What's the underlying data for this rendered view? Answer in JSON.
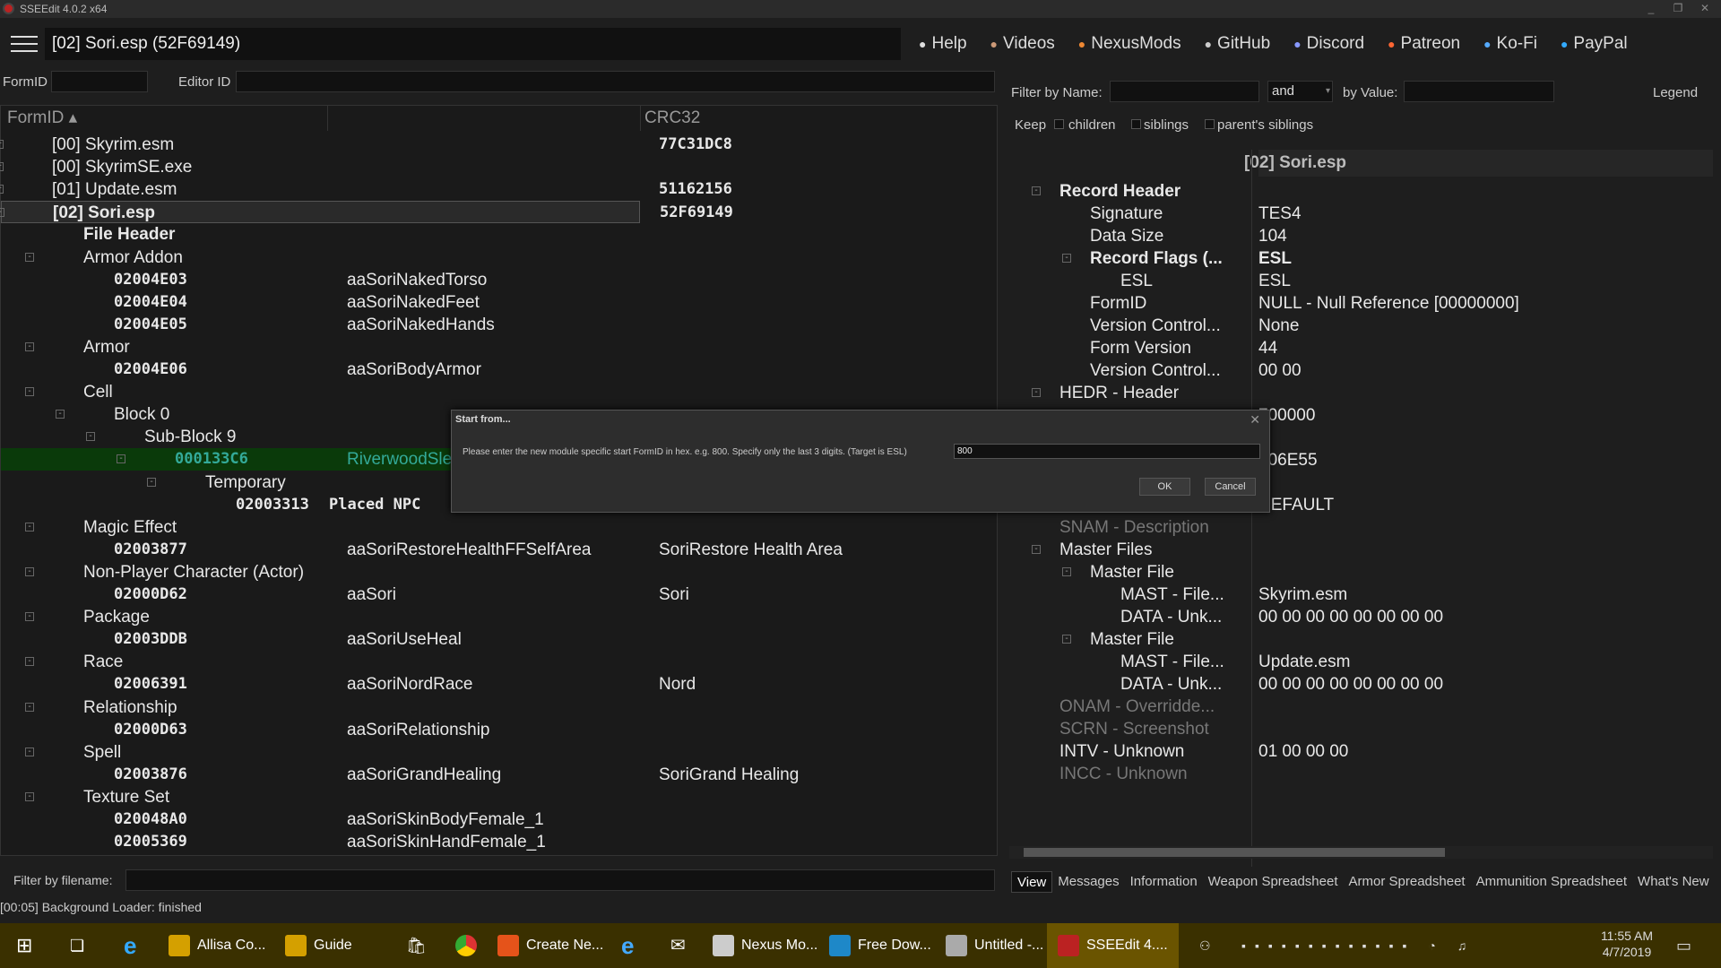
{
  "window": {
    "title": "SSEEdit 4.0.2 x64"
  },
  "header": {
    "title": "[02] Sori.esp (52F69149)",
    "links": [
      {
        "label": "Help",
        "icon": "hat-icon",
        "color": "#ddd"
      },
      {
        "label": "Videos",
        "icon": "videos-icon",
        "color": "#c97"
      },
      {
        "label": "NexusMods",
        "icon": "nexus-icon",
        "color": "#e83"
      },
      {
        "label": "GitHub",
        "icon": "github-icon",
        "color": "#ccc"
      },
      {
        "label": "Discord",
        "icon": "discord-icon",
        "color": "#89f"
      },
      {
        "label": "Patreon",
        "icon": "patreon-icon",
        "color": "#f63"
      },
      {
        "label": "Ko-Fi",
        "icon": "kofi-icon",
        "color": "#5af"
      },
      {
        "label": "PayPal",
        "icon": "paypal-icon",
        "color": "#3af"
      }
    ]
  },
  "filters": {
    "formid_label": "FormID",
    "editorid_label": "Editor ID"
  },
  "tree": {
    "col_formid": "FormID",
    "col_crc": "CRC32",
    "rows": [
      {
        "d": 0,
        "exp": "+",
        "a": "[00] Skyrim.esm",
        "c": "77C31DC8"
      },
      {
        "d": 0,
        "exp": "+",
        "a": "[00] SkyrimSE.exe",
        "c": ""
      },
      {
        "d": 0,
        "exp": "+",
        "a": "[01] Update.esm",
        "c": "51162156"
      },
      {
        "d": 0,
        "exp": "-",
        "a": "[02] Sori.esp",
        "c": "52F69149",
        "sel": true,
        "bold": true
      },
      {
        "d": 1,
        "a": "File Header",
        "bold": true
      },
      {
        "d": 1,
        "exp": "-",
        "a": "Armor Addon"
      },
      {
        "d": 2,
        "a": "02004E03",
        "b": "aaSoriNakedTorso",
        "mono": true
      },
      {
        "d": 2,
        "a": "02004E04",
        "b": "aaSoriNakedFeet",
        "mono": true
      },
      {
        "d": 2,
        "a": "02004E05",
        "b": "aaSoriNakedHands",
        "mono": true
      },
      {
        "d": 1,
        "exp": "-",
        "a": "Armor"
      },
      {
        "d": 2,
        "a": "02004E06",
        "b": "aaSoriBodyArmor",
        "mono": true
      },
      {
        "d": 1,
        "exp": "-",
        "a": "Cell"
      },
      {
        "d": 2,
        "exp": "-",
        "a": "Block 0"
      },
      {
        "d": 3,
        "exp": "-",
        "a": "Sub-Block 9"
      },
      {
        "d": 4,
        "exp": "-",
        "a": "000133C6",
        "b": "RiverwoodSle",
        "mono": true,
        "green": true
      },
      {
        "d": 5,
        "exp": "-",
        "a": "Temporary"
      },
      {
        "d": 6,
        "a": "02003313",
        "b": "Placed NPC",
        "mono": true,
        "bmono": true
      },
      {
        "d": 1,
        "exp": "-",
        "a": "Magic Effect"
      },
      {
        "d": 2,
        "a": "02003877",
        "b": "aaSoriRestoreHealthFFSelfArea",
        "c": "SoriRestore Health Area",
        "mono": true
      },
      {
        "d": 1,
        "exp": "-",
        "a": "Non-Player Character (Actor)"
      },
      {
        "d": 2,
        "a": "02000D62",
        "b": "aaSori",
        "c": "Sori",
        "mono": true
      },
      {
        "d": 1,
        "exp": "-",
        "a": "Package"
      },
      {
        "d": 2,
        "a": "02003DDB",
        "b": "aaSoriUseHeal",
        "mono": true
      },
      {
        "d": 1,
        "exp": "-",
        "a": "Race"
      },
      {
        "d": 2,
        "a": "02006391",
        "b": "aaSoriNordRace",
        "c": "Nord",
        "mono": true
      },
      {
        "d": 1,
        "exp": "-",
        "a": "Relationship"
      },
      {
        "d": 2,
        "a": "02000D63",
        "b": "aaSoriRelationship",
        "mono": true
      },
      {
        "d": 1,
        "exp": "-",
        "a": "Spell"
      },
      {
        "d": 2,
        "a": "02003876",
        "b": "aaSoriGrandHealing",
        "c": "SoriGrand Healing",
        "mono": true
      },
      {
        "d": 1,
        "exp": "-",
        "a": "Texture Set"
      },
      {
        "d": 2,
        "a": "020048A0",
        "b": "aaSoriSkinBodyFemale_1",
        "mono": true
      },
      {
        "d": 2,
        "a": "02005369",
        "b": "aaSoriSkinHandFemale_1",
        "mono": true
      }
    ]
  },
  "bottom": {
    "filter_label": "Filter by filename:",
    "status": "[00:05] Background Loader: finished"
  },
  "right": {
    "filter_name_label": "Filter by Name:",
    "and_value": "and",
    "by_value_label": "by Value:",
    "legend": "Legend",
    "keep": "Keep",
    "children": "children",
    "siblings": "siblings",
    "parents_siblings": "parent's siblings",
    "view_title": "[02] Sori.esp",
    "rows": [
      {
        "d": 0,
        "exp": "-",
        "n": "Record Header",
        "v": "",
        "bold": true
      },
      {
        "d": 1,
        "n": "Signature",
        "v": "TES4"
      },
      {
        "d": 1,
        "n": "Data Size",
        "v": "104"
      },
      {
        "d": 1,
        "exp": "-",
        "n": "Record Flags (...",
        "v": "ESL",
        "bold": true
      },
      {
        "d": 2,
        "n": "ESL",
        "v": "ESL"
      },
      {
        "d": 1,
        "n": "FormID",
        "v": "NULL - Null Reference [00000000]"
      },
      {
        "d": 1,
        "n": "Version Control...",
        "v": "None"
      },
      {
        "d": 1,
        "n": "Form Version",
        "v": "44"
      },
      {
        "d": 1,
        "n": "Version Control...",
        "v": "00 00"
      },
      {
        "d": 0,
        "exp": "-",
        "n": "HEDR - Header",
        "v": ""
      },
      {
        "d": 1,
        "n": "",
        "v": "700000"
      },
      {
        "d": 1,
        "n": "",
        "v": ""
      },
      {
        "d": 1,
        "n": "",
        "v": "006E55"
      },
      {
        "d": 1,
        "n": "",
        "v": ""
      },
      {
        "d": 0,
        "n": "CNAM - Author",
        "v": "DEFAULT"
      },
      {
        "d": 0,
        "n": "SNAM - Description",
        "v": "",
        "dim": true
      },
      {
        "d": 0,
        "exp": "-",
        "n": "Master Files",
        "v": ""
      },
      {
        "d": 1,
        "exp": "-",
        "n": "Master File",
        "v": ""
      },
      {
        "d": 2,
        "n": "MAST - File...",
        "v": "Skyrim.esm"
      },
      {
        "d": 2,
        "n": "DATA - Unk...",
        "v": "00 00 00 00 00 00 00 00"
      },
      {
        "d": 1,
        "exp": "-",
        "n": "Master File",
        "v": ""
      },
      {
        "d": 2,
        "n": "MAST - File...",
        "v": "Update.esm"
      },
      {
        "d": 2,
        "n": "DATA - Unk...",
        "v": "00 00 00 00 00 00 00 00"
      },
      {
        "d": 0,
        "n": "ONAM - Overridde...",
        "v": "",
        "dim": true
      },
      {
        "d": 0,
        "n": "SCRN - Screenshot",
        "v": "",
        "dim": true
      },
      {
        "d": 0,
        "n": "INTV - Unknown",
        "v": "01 00 00 00"
      },
      {
        "d": 0,
        "n": "INCC - Unknown",
        "v": "",
        "dim": true
      }
    ],
    "tabs": [
      "View",
      "Messages",
      "Information",
      "Weapon Spreadsheet",
      "Armor Spreadsheet",
      "Ammunition Spreadsheet",
      "What's New"
    ]
  },
  "dialog": {
    "title": "Start from...",
    "message": "Please enter the new module specific start FormID in hex. e.g. 800. Specify only the last 3 digits. (Target is ESL)",
    "value": "800",
    "ok": "OK",
    "cancel": "Cancel"
  },
  "taskbar": {
    "items": [
      {
        "label": "Allisa Co...",
        "color": "#d4a000"
      },
      {
        "label": "Guide",
        "color": "#d4a000"
      },
      {
        "label": "Create Ne...",
        "color": "#e5531a"
      },
      {
        "label": "Nexus Mo...",
        "color": "#ccc"
      },
      {
        "label": "Free Dow...",
        "color": "#1e88c8"
      },
      {
        "label": "Untitled -...",
        "color": "#aaa"
      },
      {
        "label": "SSEEdit 4....",
        "color": "#b22"
      }
    ],
    "time": "11:55 AM",
    "date": "4/7/2019"
  }
}
